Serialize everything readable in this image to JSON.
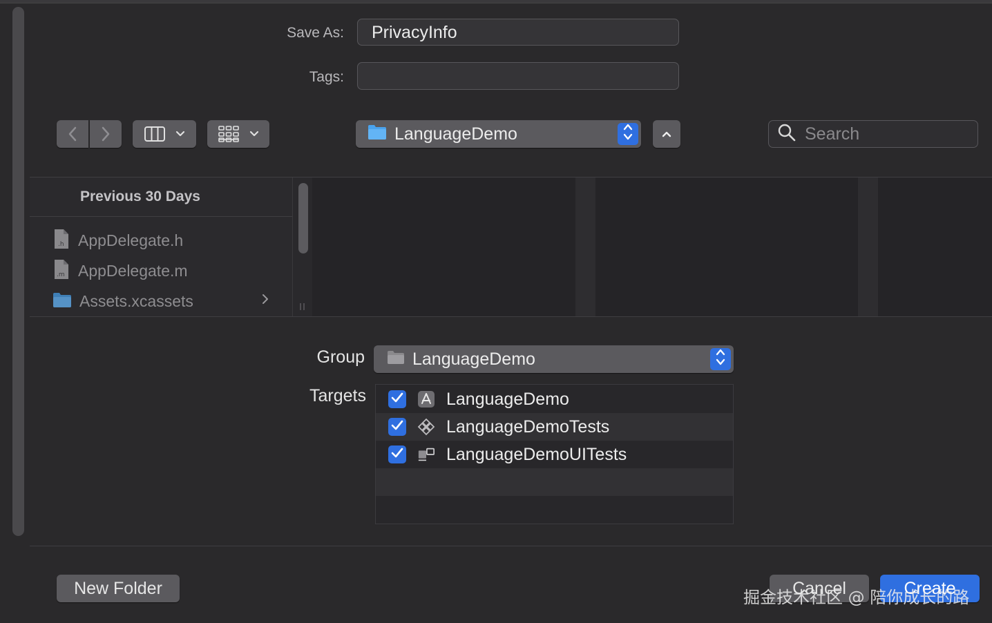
{
  "save_as": {
    "label": "Save As:",
    "value": "PrivacyInfo"
  },
  "tags": {
    "label": "Tags:",
    "value": ""
  },
  "toolbar": {
    "back_icon": "chevron-left-icon",
    "forward_icon": "chevron-right-icon",
    "view_icon": "columns-view-icon",
    "group_icon": "grid-view-icon",
    "location": "LanguageDemo",
    "search_placeholder": "Search"
  },
  "browser": {
    "section_header": "Previous 30 Days",
    "files": [
      {
        "name": "AppDelegate.h",
        "icon": "h-file-icon",
        "badge": ".h"
      },
      {
        "name": "AppDelegate.m",
        "icon": "m-file-icon",
        "badge": ".m"
      },
      {
        "name": "Assets.xcassets",
        "icon": "folder-icon",
        "badge": ""
      }
    ]
  },
  "group": {
    "label": "Group",
    "value": "LanguageDemo"
  },
  "targets": {
    "label": "Targets",
    "items": [
      {
        "name": "LanguageDemo",
        "checked": true,
        "icon": "app-target-icon"
      },
      {
        "name": "LanguageDemoTests",
        "checked": true,
        "icon": "unit-test-icon"
      },
      {
        "name": "LanguageDemoUITests",
        "checked": true,
        "icon": "ui-test-icon"
      }
    ]
  },
  "buttons": {
    "new_folder": "New Folder",
    "cancel": "Cancel",
    "create": "Create"
  },
  "watermark": "掘金技术社区 @ 陪你成长的路",
  "colors": {
    "accent": "#2f6fe0",
    "window_bg": "#2a292b",
    "button_bg": "#5b5a5e"
  }
}
